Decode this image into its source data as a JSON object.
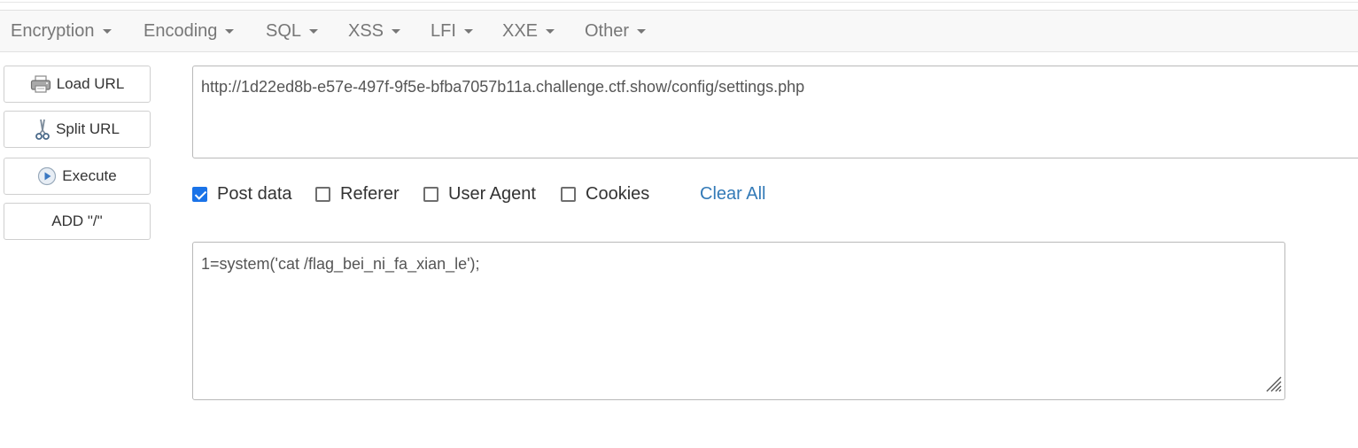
{
  "menu": {
    "items": [
      {
        "label": "Encryption",
        "icon": "caret-down-icon"
      },
      {
        "label": "Encoding",
        "icon": "caret-down-icon"
      },
      {
        "label": "SQL",
        "icon": "caret-down-icon"
      },
      {
        "label": "XSS",
        "icon": "caret-down-icon"
      },
      {
        "label": "LFI",
        "icon": "caret-down-icon"
      },
      {
        "label": "XXE",
        "icon": "caret-down-icon"
      },
      {
        "label": "Other",
        "icon": "caret-down-icon"
      }
    ]
  },
  "actions": {
    "load_url": {
      "label": "Load URL",
      "icon": "printer-icon"
    },
    "split_url": {
      "label": "Split URL",
      "icon": "scissors-icon"
    },
    "execute": {
      "label": "Execute",
      "icon": "play-icon"
    },
    "add_slash": {
      "label": "ADD \"/\""
    }
  },
  "url": {
    "value": "http://1d22ed8b-e57e-497f-9f5e-bfba7057b11a.challenge.ctf.show/config/settings.php"
  },
  "options": {
    "post_data": {
      "label": "Post data",
      "checked": true
    },
    "referer": {
      "label": "Referer",
      "checked": false
    },
    "user_agent": {
      "label": "User Agent",
      "checked": false
    },
    "cookies": {
      "label": "Cookies",
      "checked": false
    },
    "clear_all": "Clear All"
  },
  "post": {
    "value": "1=system('cat /flag_bei_ni_fa_xian_le');"
  },
  "colors": {
    "accent": "#1a73e8",
    "link": "#337ab7",
    "menu_bg": "#f8f8f8"
  }
}
